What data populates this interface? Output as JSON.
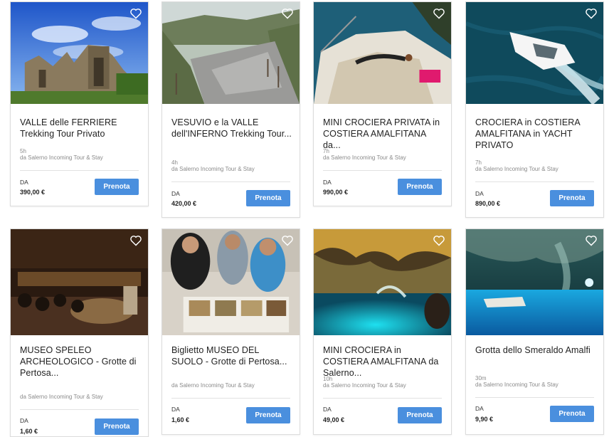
{
  "colors": {
    "button": "#4a8fde",
    "divider": "#e2e2e2",
    "meta": "#8a8a8a"
  },
  "cards": [
    {
      "title": "VALLE delle FERRIERE Trekking Tour Privato",
      "duration": "5h",
      "provider": "da Salerno Incoming Tour & Stay",
      "da": "DA",
      "price": "390,00 €",
      "button": "Prenota",
      "icon": "heart-icon"
    },
    {
      "title": "VESUVIO e la VALLE dell'INFERNO Trekking Tour...",
      "duration": "4h",
      "provider": "da Salerno Incoming Tour & Stay",
      "da": "DA",
      "price": "420,00 €",
      "button": "Prenota",
      "icon": "heart-icon"
    },
    {
      "title": "MINI CROCIERA PRIVATA in COSTIERA AMALFITANA da...",
      "duration": "7h",
      "provider": "da Salerno Incoming Tour & Stay",
      "da": "DA",
      "price": "990,00 €",
      "button": "Prenota",
      "icon": "heart-icon"
    },
    {
      "title": "CROCIERA in COSTIERA AMALFITANA in YACHT PRIVATO",
      "duration": "7h",
      "provider": "da Salerno Incoming Tour & Stay",
      "da": "DA",
      "price": "890,00 €",
      "button": "Prenota",
      "icon": "heart-icon"
    },
    {
      "title": "MUSEO SPELEO ARCHEOLOGICO - Grotte di Pertosa...",
      "duration": "",
      "provider": "da Salerno Incoming Tour & Stay",
      "da": "DA",
      "price": "1,60 €",
      "button": "Prenota",
      "icon": "heart-icon"
    },
    {
      "title": "Biglietto MUSEO DEL SUOLO - Grotte di Pertosa...",
      "duration": "",
      "provider": "da Salerno Incoming Tour & Stay",
      "da": "DA",
      "price": "1,60 €",
      "button": "Prenota",
      "icon": "heart-icon"
    },
    {
      "title": "MINI CROCIERA in COSTIERA AMALFITANA da Salerno...",
      "duration": "10h",
      "provider": "da Salerno Incoming Tour & Stay",
      "da": "DA",
      "price": "49,00 €",
      "button": "Prenota",
      "icon": "heart-icon"
    },
    {
      "title": "Grotta dello Smeraldo Amalfi",
      "duration": "30m",
      "provider": "da Salerno Incoming Tour & Stay",
      "da": "DA",
      "price": "9,90 €",
      "button": "Prenota",
      "icon": "heart-icon"
    }
  ]
}
